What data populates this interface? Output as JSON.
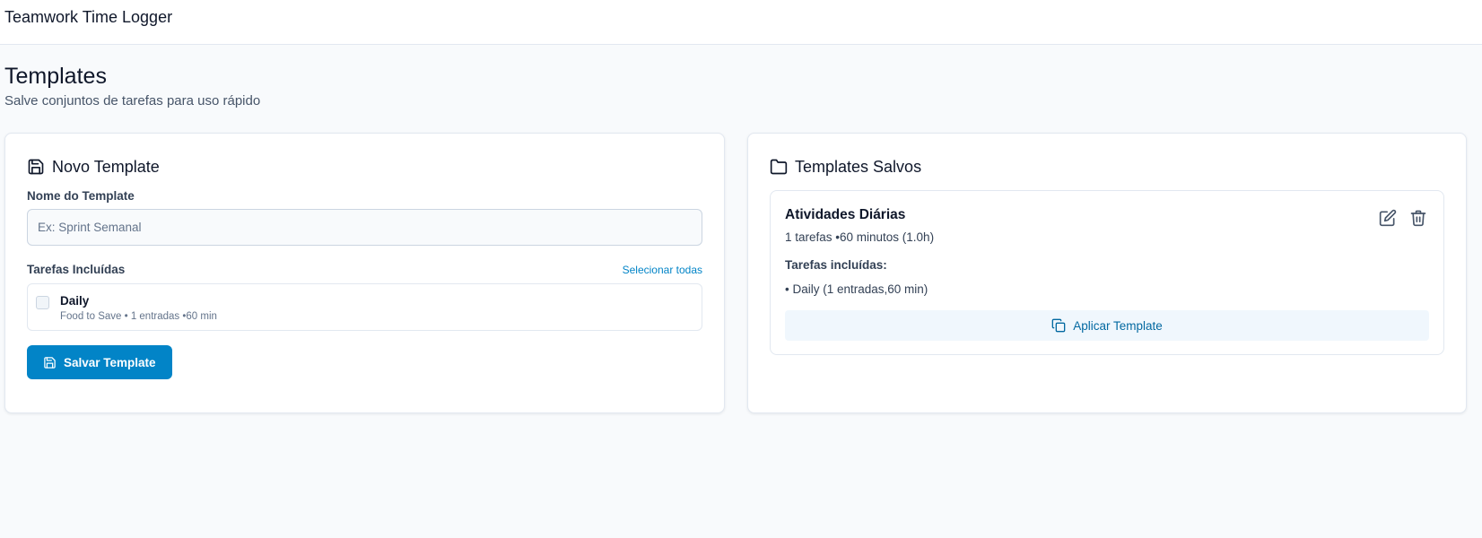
{
  "app": {
    "title": "Teamwork Time Logger"
  },
  "page": {
    "title": "Templates",
    "subtitle": "Salve conjuntos de tarefas para uso rápido"
  },
  "new_template": {
    "header_icon": "save-icon",
    "title": "Novo Template",
    "name_label": "Nome do Template",
    "name_value": "",
    "name_placeholder": "Ex: Sprint Semanal",
    "tasks_label": "Tarefas Incluídas",
    "select_all_label": "Selecionar todas",
    "tasks": [
      {
        "name": "Daily",
        "meta": "Food to Save • 1 entradas •60 min",
        "checked": false
      }
    ],
    "save_button_label": "Salvar Template",
    "save_button_icon": "save-icon"
  },
  "saved_templates": {
    "header_icon": "folder-icon",
    "title": "Templates Salvos",
    "items": [
      {
        "name": "Atividades Diárias",
        "meta": "1 tarefas •60 minutos (1.0h)",
        "included_label": "Tarefas incluídas:",
        "included": [
          "• Daily (1 entradas,60 min)"
        ],
        "apply_label": "Aplicar Template",
        "apply_icon": "copy-icon",
        "edit_icon": "edit-icon",
        "delete_icon": "trash-icon"
      }
    ]
  },
  "colors": {
    "primary": "#0284c7",
    "background": "#f8fafc",
    "card": "#ffffff",
    "border": "#e2e8f0",
    "apply_bg": "#f0f7fd"
  }
}
